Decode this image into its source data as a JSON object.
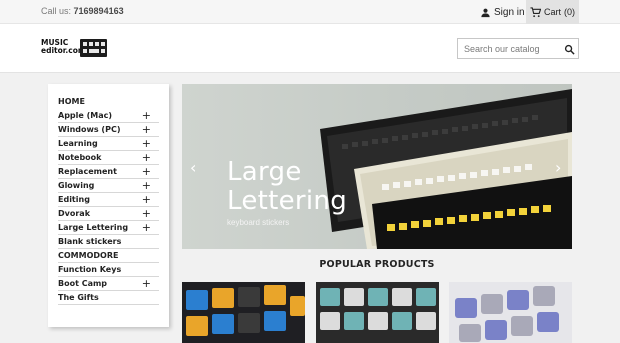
{
  "topbar": {
    "call_label": "Call us:",
    "phone": "7169894163",
    "signin_label": "Sign in",
    "cart_label": "Cart",
    "cart_count": "(0)"
  },
  "header": {
    "logo_line1": "MUSIC",
    "logo_line2": "editor.com",
    "search_placeholder": "Search our catalog"
  },
  "sidebar": {
    "items": [
      {
        "label": "HOME",
        "has_children": false
      },
      {
        "label": "Apple (Mac)",
        "has_children": true
      },
      {
        "label": "Windows (PC)",
        "has_children": true
      },
      {
        "label": "Learning",
        "has_children": true
      },
      {
        "label": "Notebook",
        "has_children": true
      },
      {
        "label": "Replacement",
        "has_children": true
      },
      {
        "label": "Glowing",
        "has_children": true
      },
      {
        "label": "Editing",
        "has_children": true
      },
      {
        "label": "Dvorak",
        "has_children": true
      },
      {
        "label": "Large Lettering",
        "has_children": true
      },
      {
        "label": "Blank stickers",
        "has_children": false
      },
      {
        "label": "COMMODORE",
        "has_children": false
      },
      {
        "label": "Function Keys",
        "has_children": false
      },
      {
        "label": "Boot Camp",
        "has_children": true
      },
      {
        "label": "The Gifts",
        "has_children": false
      }
    ]
  },
  "slider": {
    "title": "Large\nLettering",
    "subtitle": "keyboard stickers"
  },
  "popular_heading": "POPULAR PRODUCTS",
  "icons": {
    "user": "user-icon",
    "cart": "cart-icon",
    "search": "search-icon",
    "plus": "plus-icon",
    "prev": "chevron-left-icon",
    "next": "chevron-right-icon"
  },
  "colors": {
    "topbar_bg": "#f6f6f6",
    "cart_bg": "#e2e2e2",
    "page_bg": "#f1f1f1",
    "text": "#232323"
  }
}
